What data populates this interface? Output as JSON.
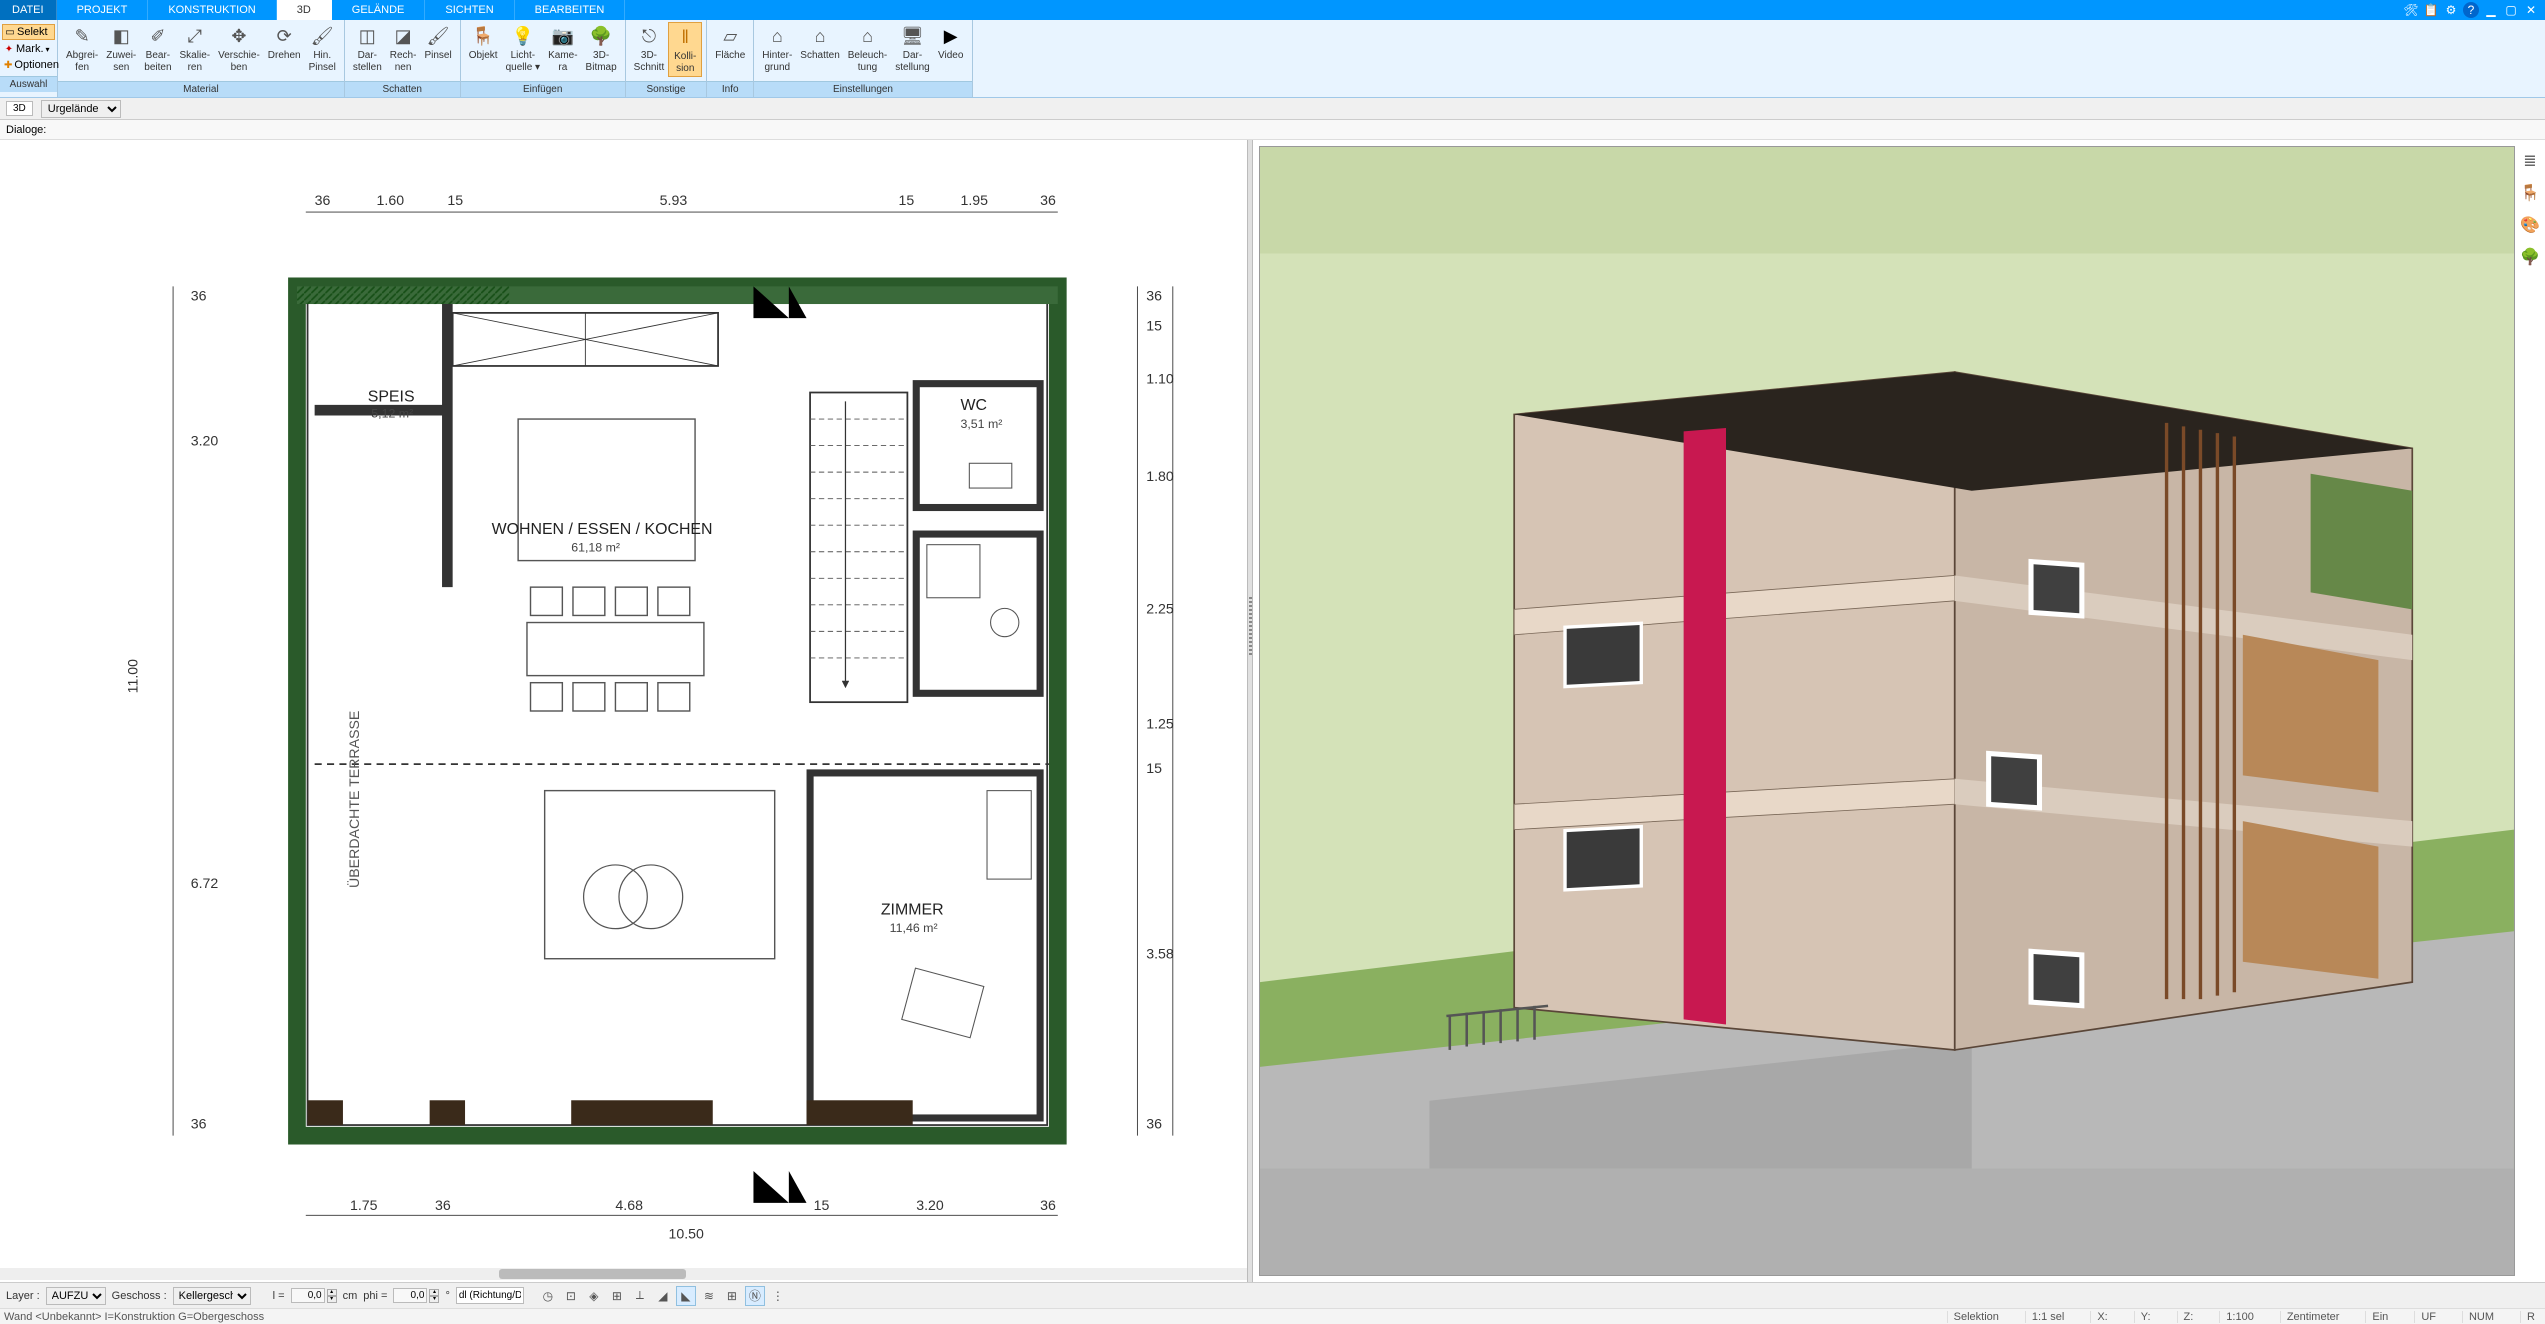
{
  "menu": {
    "tabs": [
      "DATEI",
      "PROJEKT",
      "KONSTRUKTION",
      "3D",
      "GELÄNDE",
      "SICHTEN",
      "BEARBEITEN"
    ],
    "active": 3
  },
  "ribbon": {
    "auswahl": {
      "selekt": "Selekt",
      "mark": "Mark.",
      "optionen": "Optionen",
      "label": "Auswahl"
    },
    "material": {
      "items": [
        "Abgrei-\nfen",
        "Zuwei-\nsen",
        "Bear-\nbeiten",
        "Skalie-\nren",
        "Verschie-\nben",
        "Drehen",
        "Hin.\nPinsel"
      ],
      "label": "Material"
    },
    "schatten": {
      "items": [
        "Dar-\nstellen",
        "Rech-\nnen",
        "Pinsel"
      ],
      "label": "Schatten"
    },
    "einfuegen": {
      "items": [
        "Objekt",
        "Licht-\nquelle ▾",
        "Kame-\nra",
        "3D-\nBitmap"
      ],
      "label": "Einfügen"
    },
    "sonstige": {
      "items": [
        "3D-\nSchnitt",
        "Kolli-\nsion"
      ],
      "label": "Sonstige",
      "active": 1
    },
    "info": {
      "items": [
        "Fläche"
      ],
      "label": "Info"
    },
    "einstellungen": {
      "items": [
        "Hinter-\ngrund",
        "Schatten",
        "Beleuch-\ntung",
        "Dar-\nstellung",
        "Video"
      ],
      "label": "Einstellungen"
    }
  },
  "subbar": {
    "tag": "3D",
    "dropdown": "Urgelände"
  },
  "dlgbar": {
    "label": "Dialoge:"
  },
  "plan": {
    "rooms": {
      "speis": {
        "name": "SPEIS",
        "area": "5,12 m²"
      },
      "wohnen": {
        "name": "WOHNEN / ESSEN / KOCHEN",
        "area": "61,18 m²"
      },
      "wc": {
        "name": "WC",
        "area": "3,51 m²"
      },
      "zimmer": {
        "name": "ZIMMER",
        "area": "11,46 m²"
      },
      "terrasse": "ÜBERDACHTE TERRASSE"
    },
    "dims_top": [
      "36",
      "1.60",
      "15",
      "5.93",
      "15",
      "1.95",
      "36"
    ],
    "dims_bottom": [
      "1.75",
      "36",
      "4.68",
      "15",
      "3.20",
      "36"
    ],
    "dims_total": "10.50",
    "dims_left": [
      "36",
      "3.20",
      "6.72",
      "36"
    ],
    "dims_left_total": "11.00",
    "dims_right": [
      "36",
      "15",
      "1.10",
      "1.80",
      "2.25",
      "1.25",
      "15",
      "3.58",
      "36"
    ]
  },
  "bottombar": {
    "layer_lbl": "Layer :",
    "layer": "AUFZUG",
    "geschoss_lbl": "Geschoss :",
    "geschoss": "Kellergesch",
    "l_lbl": "l =",
    "l_val": "0,0",
    "l_unit": "cm",
    "phi_lbl": "phi =",
    "phi_val": "0,0",
    "phi_unit": "°",
    "snap": "dl (Richtung/Di"
  },
  "status": {
    "left": "Wand <Unbekannt> I=Konstruktion G=Obergeschoss",
    "selektion": "Selektion",
    "sel": "1:1 sel",
    "x": "X:",
    "y": "Y:",
    "z": "Z:",
    "scale": "1:100",
    "unit": "Zentimeter",
    "ein": "Ein",
    "uf": "UF",
    "num": "NUM",
    "r": "R"
  }
}
